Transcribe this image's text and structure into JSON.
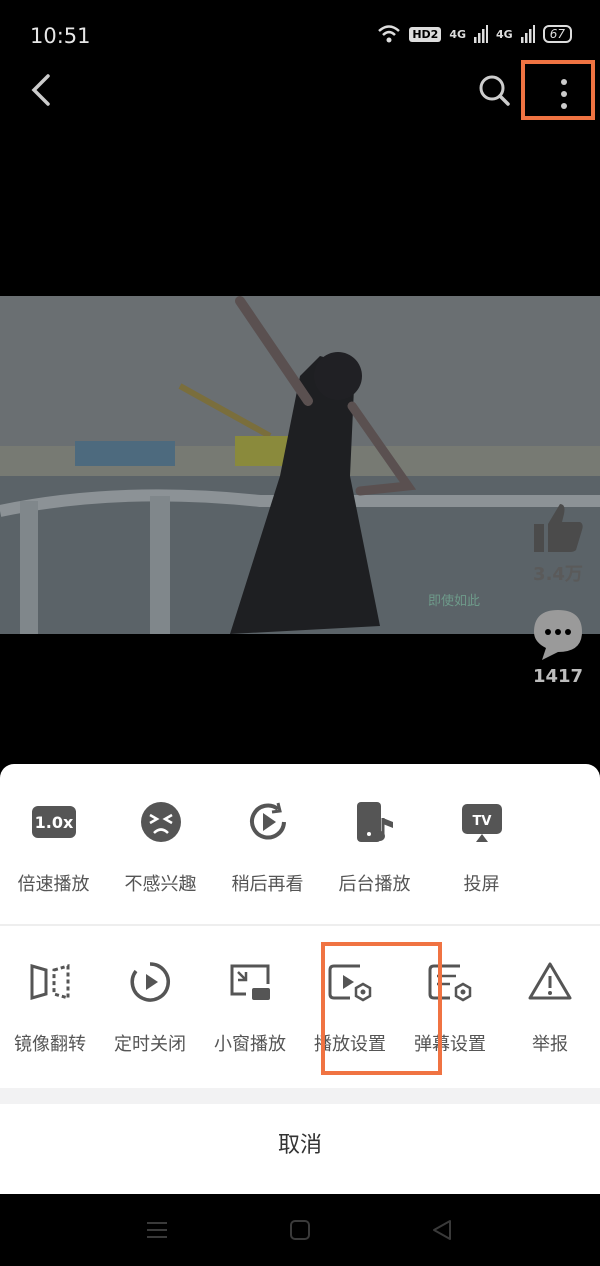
{
  "status": {
    "time": "10:51",
    "hd_badge": "HD2",
    "network_1": "4G",
    "network_2": "4G",
    "battery": "67"
  },
  "topbar": {
    "back_icon": "chevron-left-icon",
    "search_icon": "search-icon",
    "more_icon": "more-vertical-icon"
  },
  "video": {
    "watermark": "即使如此"
  },
  "side": {
    "likes": "3.4万",
    "comments": "1417"
  },
  "sheet": {
    "row1": [
      {
        "label": "倍速播放",
        "icon": "speed-icon",
        "badge": "1.0x"
      },
      {
        "label": "不感兴趣",
        "icon": "dislike-face-icon"
      },
      {
        "label": "稍后再看",
        "icon": "watch-later-icon"
      },
      {
        "label": "后台播放",
        "icon": "background-play-icon"
      },
      {
        "label": "投屏",
        "icon": "tv-cast-icon",
        "badge": "TV"
      }
    ],
    "row2": [
      {
        "label": "镜像翻转",
        "icon": "mirror-flip-icon"
      },
      {
        "label": "定时关闭",
        "icon": "timer-icon"
      },
      {
        "label": "小窗播放",
        "icon": "mini-window-icon"
      },
      {
        "label": "播放设置",
        "icon": "play-settings-icon"
      },
      {
        "label": "弹幕设置",
        "icon": "danmaku-settings-icon"
      },
      {
        "label": "举报",
        "icon": "report-icon"
      }
    ],
    "cancel": "取消"
  },
  "colors": {
    "highlight": "#f07342",
    "icon_gray": "#555555",
    "sheet_bg": "#ffffff"
  }
}
